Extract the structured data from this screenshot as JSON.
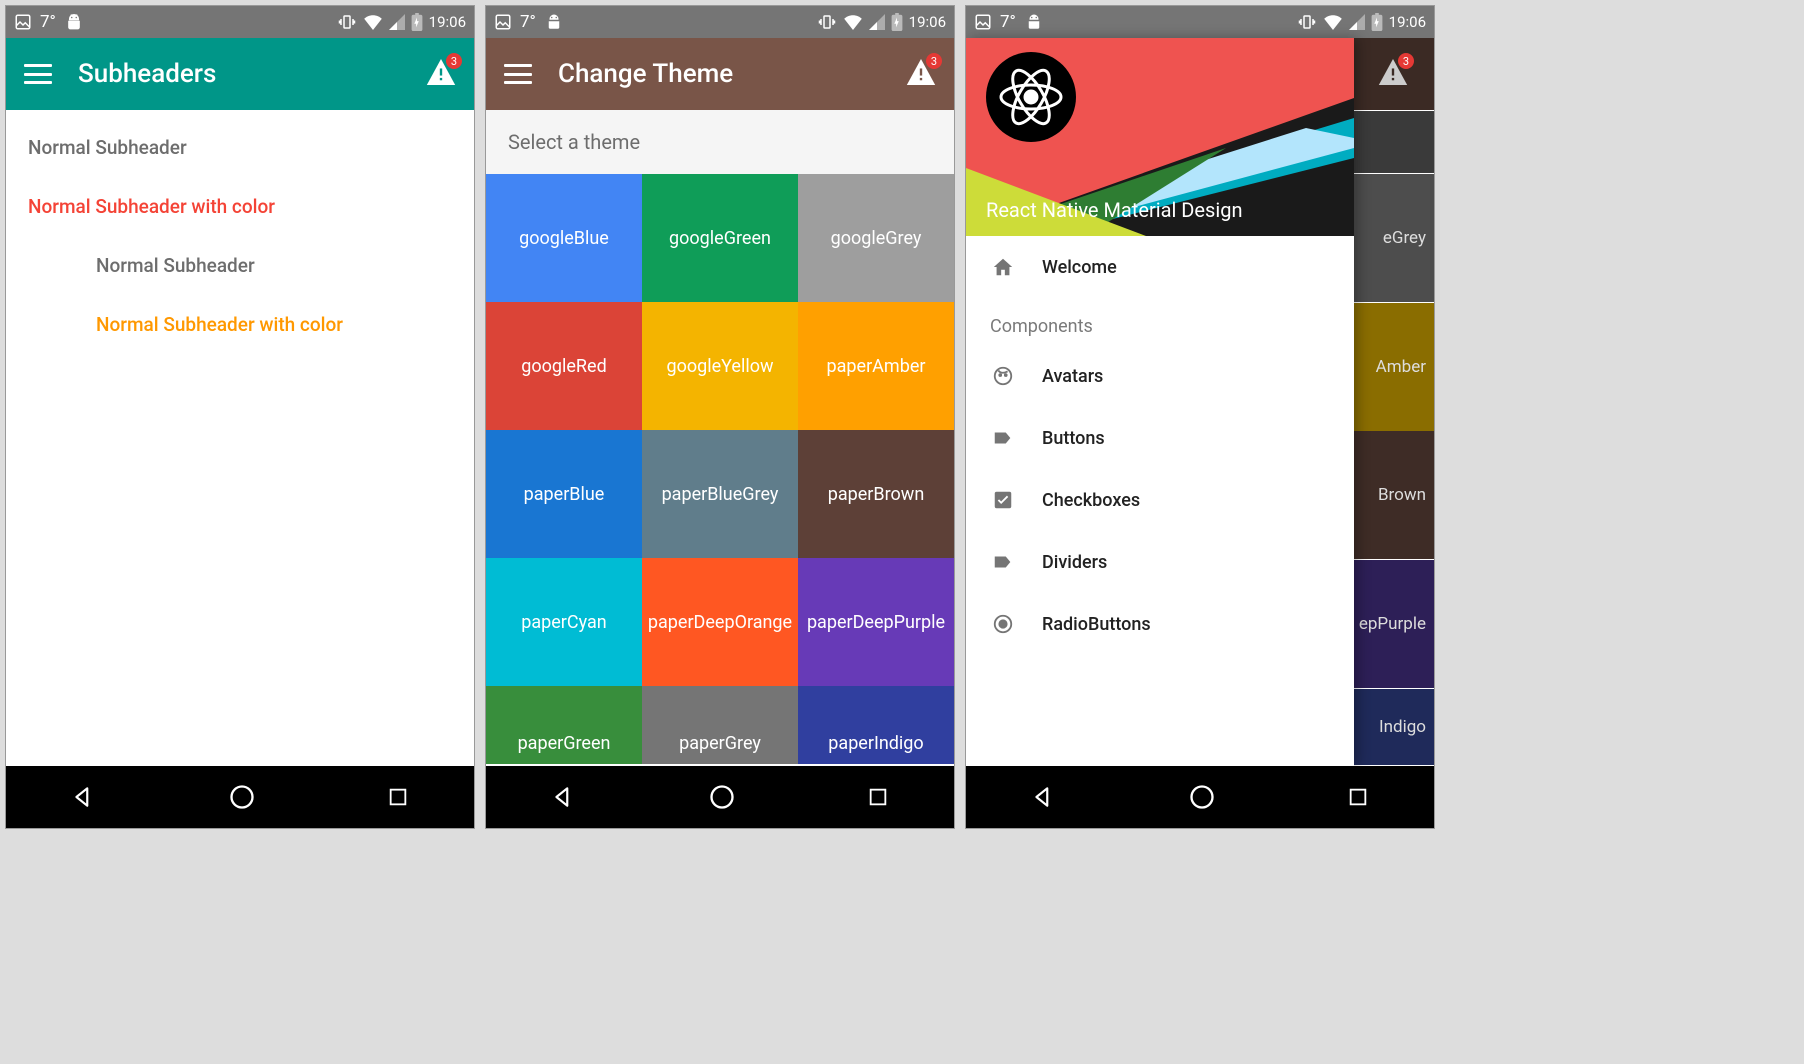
{
  "statusbar": {
    "temp": "7°",
    "time": "19:06"
  },
  "badge_count": "3",
  "screen1": {
    "title": "Subheaders",
    "appbar_color": "#009688",
    "subheaders": [
      {
        "text": "Normal Subheader",
        "cls": "sub-normal"
      },
      {
        "text": "Normal Subheader with color",
        "cls": "sub-red"
      },
      {
        "text": "Normal Subheader",
        "cls": "sub-normal sub-inset"
      },
      {
        "text": "Normal Subheader with color",
        "cls": "sub-orange sub-inset"
      }
    ]
  },
  "screen2": {
    "title": "Change Theme",
    "appbar_color": "#795548",
    "select_label": "Select a theme",
    "themes": [
      {
        "name": "googleBlue",
        "color": "#4285F4"
      },
      {
        "name": "googleGreen",
        "color": "#0F9D58"
      },
      {
        "name": "googleGrey",
        "color": "#9E9E9E"
      },
      {
        "name": "googleRed",
        "color": "#DB4437"
      },
      {
        "name": "googleYellow",
        "color": "#F4B400"
      },
      {
        "name": "paperAmber",
        "color": "#FFA000"
      },
      {
        "name": "paperBlue",
        "color": "#1976D2"
      },
      {
        "name": "paperBlueGrey",
        "color": "#607D8B"
      },
      {
        "name": "paperBrown",
        "color": "#5D4037"
      },
      {
        "name": "paperCyan",
        "color": "#00BCD4"
      },
      {
        "name": "paperDeepOrange",
        "color": "#FF5722"
      },
      {
        "name": "paperDeepPurple",
        "color": "#673AB7"
      },
      {
        "name": "paperGreen",
        "color": "#388E3C"
      },
      {
        "name": "paperGrey",
        "color": "#757575"
      },
      {
        "name": "paperIndigo",
        "color": "#303F9F"
      }
    ]
  },
  "screen3": {
    "drawer_title": "React Native Material Design",
    "bg_labels": [
      "eGrey",
      "Amber",
      "Brown",
      "epPurple",
      "Indigo"
    ],
    "drawer": {
      "welcome": "Welcome",
      "section": "Components",
      "items": [
        {
          "icon": "face",
          "label": "Avatars"
        },
        {
          "icon": "label",
          "label": "Buttons"
        },
        {
          "icon": "checkbox",
          "label": "Checkboxes"
        },
        {
          "icon": "label",
          "label": "Dividers"
        },
        {
          "icon": "radio",
          "label": "RadioButtons"
        }
      ]
    }
  }
}
